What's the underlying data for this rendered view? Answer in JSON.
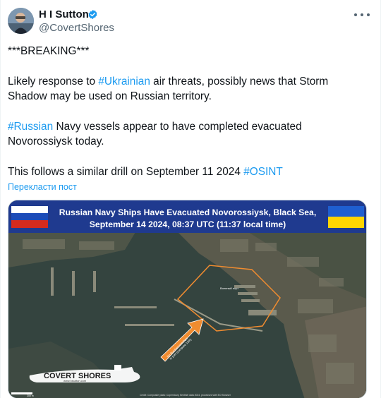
{
  "author": {
    "name": "H I Sutton",
    "handle": "@CovertShores",
    "verified": true,
    "avatar_icon": "profile-photo"
  },
  "tweet": {
    "line1": "***BREAKING***",
    "p2_prefix": "Likely response to ",
    "p2_tag": "#Ukrainian",
    "p2_suffix": " air threats, possibly news that Storm",
    "p2_line2": "Shadow may be used on Russian territory.",
    "p3_tag": "#Russian",
    "p3_suffix": " Navy vessels appear to have completed evacuated",
    "p3_line2": "Novorossiysk today.",
    "p4_prefix": "This follows a similar drill on September 11 2024 ",
    "p4_tag": "#OSINT"
  },
  "translate_label": "Перекласти пост",
  "image": {
    "title_line1": "Russian Navy Ships Have Evacuated Novorossiysk, Black Sea,",
    "title_line2": "September 14 2024, 08:37 UTC (11:37 local time)",
    "arrow_text_line1": "No Russian warships",
    "arrow_text_line2": "in port (compare 12th)",
    "logo_text": "COVERT SHORES",
    "logo_url": "www.hisutton.com",
    "credit": "Credit: Composite (data: Copernicus) Sentinel data 2024, processed with EO Browser",
    "map_label": "Военный порт",
    "scale_text": "200 m",
    "flags": [
      "russia",
      "ukraine"
    ],
    "colors": {
      "banner": "#1f3a8f",
      "outline": "#f08c30",
      "arrow": "#f08c30",
      "hashtag": "#1d9bf0"
    }
  }
}
